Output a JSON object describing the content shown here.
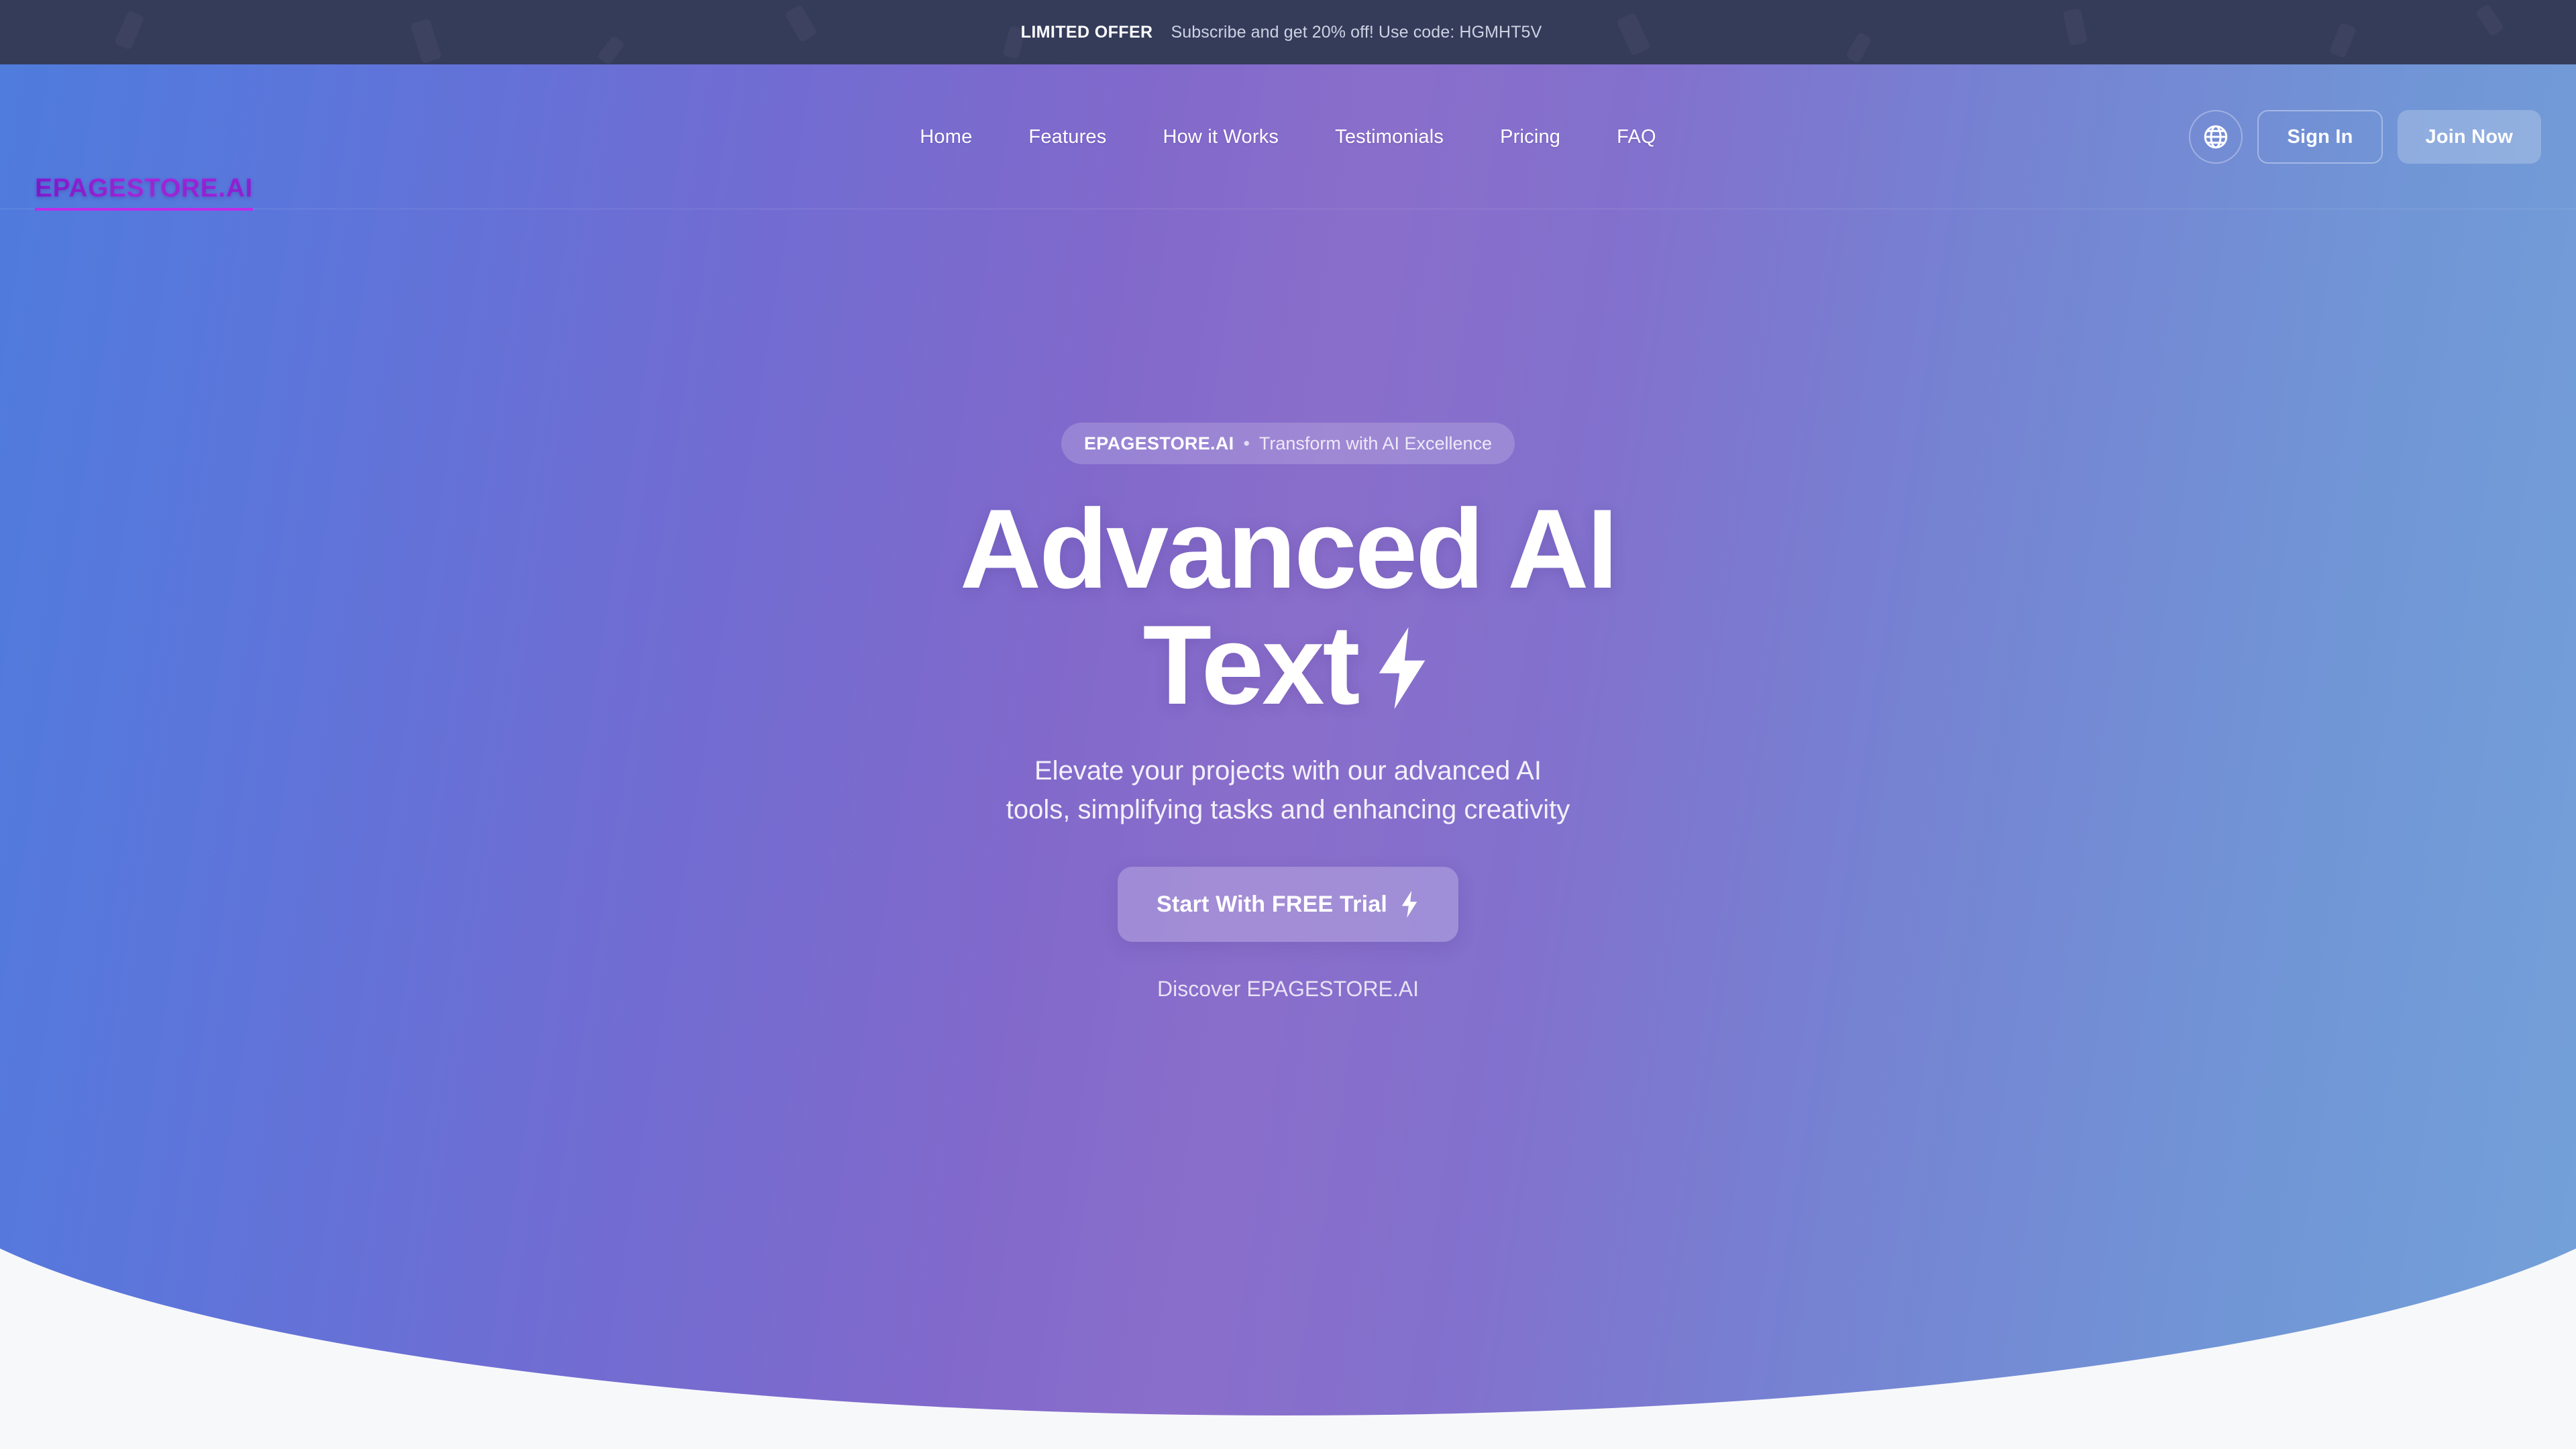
{
  "banner": {
    "tag": "LIMITED OFFER",
    "message": "Subscribe and get 20% off! Use code: HGMHT5V"
  },
  "nav": {
    "logo": "EPAGESTORE.AI",
    "links": [
      {
        "label": "Home"
      },
      {
        "label": "Features"
      },
      {
        "label": "How it Works"
      },
      {
        "label": "Testimonials"
      },
      {
        "label": "Pricing"
      },
      {
        "label": "FAQ"
      }
    ],
    "language_icon": "globe-icon",
    "sign_in": "Sign In",
    "join_now": "Join Now"
  },
  "hero": {
    "badge_brand": "EPAGESTORE.AI",
    "badge_separator": "•",
    "badge_text": "Transform with AI Excellence",
    "title_line1": "Advanced AI",
    "title_line2": "Text",
    "title_icon": "lightning-bolt-icon",
    "subtitle": "Elevate your projects with our advanced AI tools, simplifying tasks and enhancing creativity",
    "cta_label": "Start With FREE Trial",
    "cta_icon": "lightning-bolt-icon",
    "discover_link": "Discover EPAGESTORE.AI"
  },
  "colors": {
    "banner_bg": "#353c5a",
    "gradient_left": "#4a7ede",
    "gradient_mid": "#8169cb",
    "gradient_right": "#74a4d9",
    "logo_accent": "#b32ae8",
    "page_bg": "#f7f8fa"
  }
}
